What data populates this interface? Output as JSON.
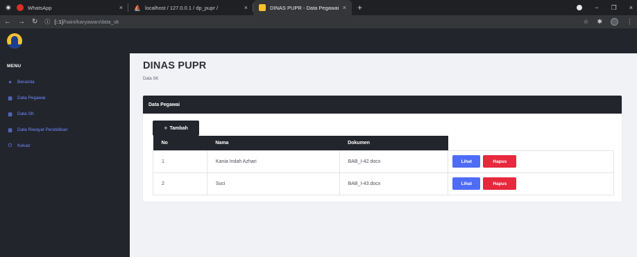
{
  "browser": {
    "tabs": [
      {
        "title": "WhatsApp",
        "favicon": "whatsapp-icon"
      },
      {
        "title": "localhost / 127.0.0.1 / dp_pupr / ",
        "favicon": "phpmyadmin-icon"
      },
      {
        "title": "DINAS PUPR - Data Pegawai",
        "favicon": "pupr-icon"
      }
    ],
    "close_glyph": "×",
    "new_tab_glyph": "+",
    "url_host": "[::1]",
    "url_path": "/haini/karyawan/data_sk",
    "minimize_glyph": "−",
    "maximize_glyph": "❐",
    "close_window_glyph": "×"
  },
  "sidebar": {
    "menu_title": "MENU",
    "items": [
      {
        "label": "Beranda",
        "icon": "home-icon"
      },
      {
        "label": "Data Pegawai",
        "icon": "table-icon"
      },
      {
        "label": "Data SK",
        "icon": "table-icon"
      },
      {
        "label": "Data Riwayat Pendidikan",
        "icon": "table-icon"
      },
      {
        "label": "Keluar",
        "icon": "power-icon"
      }
    ]
  },
  "main": {
    "page_title": "DINAS PUPR",
    "breadcrumb": "Data SK",
    "card_title": "Data Pegawai",
    "add_button": "Tambah",
    "table": {
      "headers": [
        "No",
        "Nama",
        "Dokumen"
      ],
      "rows": [
        {
          "no": "1",
          "nama": "Kania Indah Azhari",
          "dokumen": "BAB_I-42.docx"
        },
        {
          "no": "2",
          "nama": "Suci",
          "dokumen": "BAB_I-43.docx"
        }
      ],
      "view_label": "Lihat",
      "delete_label": "Hapus"
    }
  },
  "colors": {
    "dark": "#23252d",
    "link_blue": "#6f89ff",
    "view_button": "#4e6cf6",
    "delete_button": "#e8283c",
    "page_bg": "#f1f2f6"
  }
}
